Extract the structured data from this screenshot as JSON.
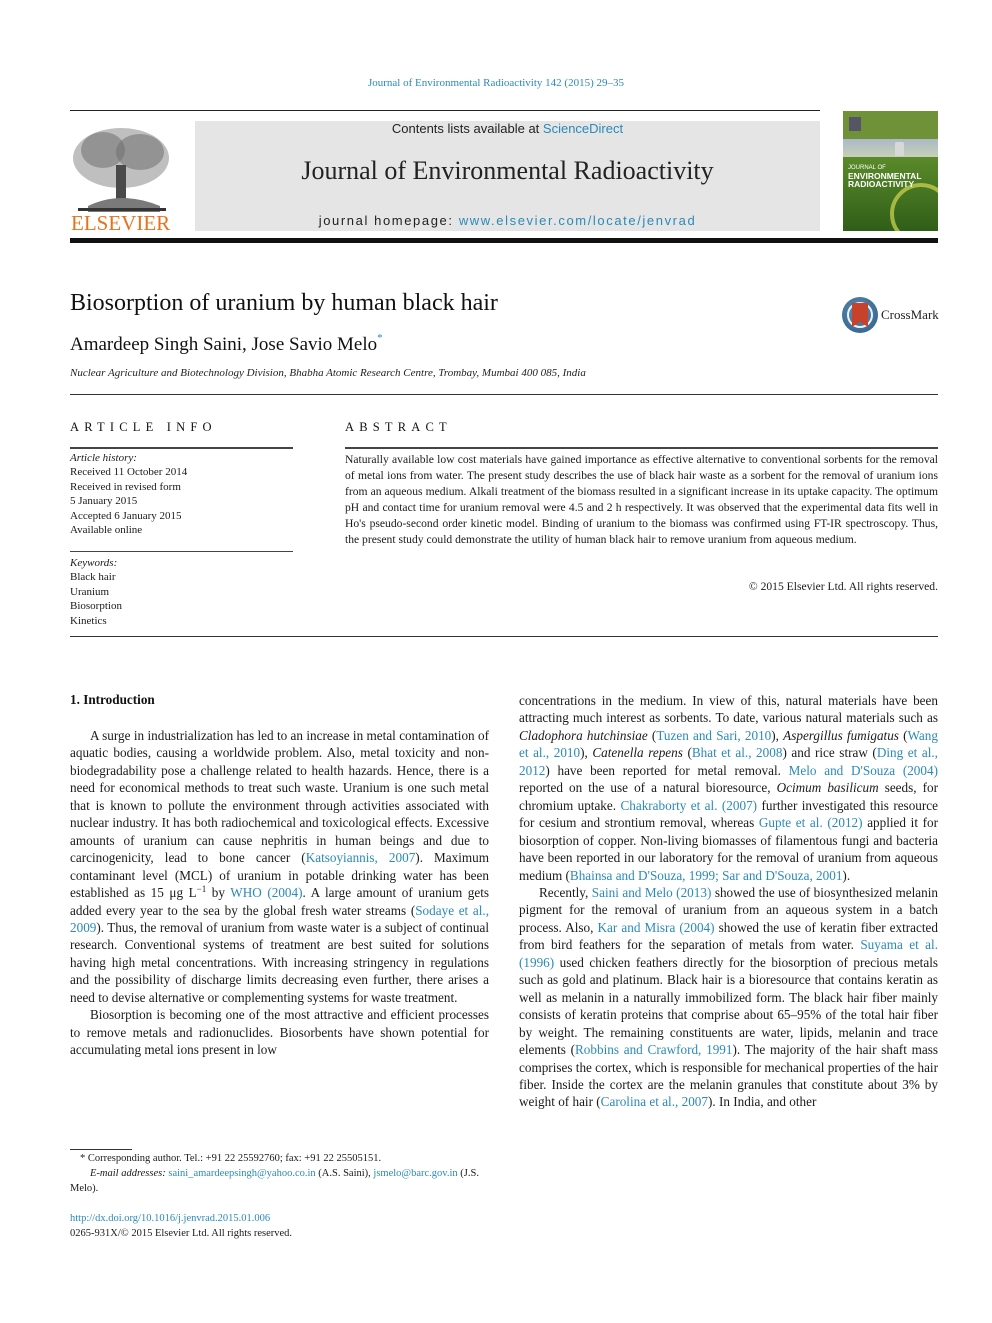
{
  "journal_ref": "Journal of Environmental Radioactivity 142 (2015) 29–35",
  "header": {
    "contents_prefix": "Contents lists available at ",
    "contents_link": "ScienceDirect",
    "journal_title": "Journal of Environmental Radioactivity",
    "homepage_prefix": "journal homepage: ",
    "homepage_link": "www.elsevier.com/locate/jenvrad",
    "publisher_logo": "ELSEVIER",
    "cover_title_lines": [
      "JOURNAL OF",
      "ENVIRONMENTAL",
      "RADIOACTIVITY"
    ],
    "brand_color": "#e9711c",
    "link_color": "#2a8ab8"
  },
  "article": {
    "title": "Biosorption of uranium by human black hair",
    "authors": "Amardeep Singh Saini, Jose Savio Melo",
    "corresponding_mark": "*",
    "affiliation": "Nuclear Agriculture and Biotechnology Division, Bhabha Atomic Research Centre, Trombay, Mumbai 400 085, India",
    "crossmark_label": "CrossMark"
  },
  "article_info": {
    "heading": "ARTICLE INFO",
    "history_label": "Article history:",
    "history": [
      "Received 11 October 2014",
      "Received in revised form",
      "5 January 2015",
      "Accepted 6 January 2015",
      "Available online"
    ],
    "keywords_label": "Keywords:",
    "keywords": [
      "Black hair",
      "Uranium",
      "Biosorption",
      "Kinetics"
    ]
  },
  "abstract": {
    "heading": "ABSTRACT",
    "text": "Naturally available low cost materials have gained importance as effective alternative to conventional sorbents for the removal of metal ions from water. The present study describes the use of black hair waste as a sorbent for the removal of uranium ions from an aqueous medium. Alkali treatment of the biomass resulted in a significant increase in its uptake capacity. The optimum pH and contact time for uranium removal were 4.5 and 2 h respectively. It was observed that the experimental data fits well in Ho's pseudo-second order kinetic model. Binding of uranium to the biomass was confirmed using FT-IR spectroscopy. Thus, the present study could demonstrate the utility of human black hair to remove uranium from aqueous medium.",
    "copyright": "© 2015 Elsevier Ltd. All rights reserved."
  },
  "body": {
    "section_heading": "1.  Introduction",
    "left_p1": [
      {
        "t": "A surge in industrialization has led to an increase in metal contamination of aquatic bodies, causing a worldwide problem. Also, metal toxicity and non-biodegradability pose a challenge related to health hazards. Hence, there is a need for economical methods to treat such waste. Uranium is one such metal that is known to pollute the environment through activities associated with nuclear industry. It has both radiochemical and toxicological effects. Excessive amounts of uranium can cause nephritis in human beings and due to carcinogenicity, lead to bone cancer ("
      },
      {
        "t": "Katsoyiannis, 2007",
        "link": true
      },
      {
        "t": "). Maximum contaminant level (MCL) of uranium in potable drinking water has been established as 15 μg L"
      },
      {
        "t": "−1",
        "sup": true
      },
      {
        "t": " by "
      },
      {
        "t": "WHO (2004)",
        "link": true
      },
      {
        "t": ". A large amount of uranium gets added every year to the sea by the global fresh water streams ("
      },
      {
        "t": "Sodaye et al., 2009",
        "link": true
      },
      {
        "t": "). Thus, the removal of uranium from waste water is a subject of continual research. Conventional systems of treatment are best suited for solutions having high metal concentrations. With increasing stringency in regulations and the possibility of discharge limits decreasing even further, there arises a need to devise alternative or complementing systems for waste treatment."
      }
    ],
    "left_p2": [
      {
        "t": "Biosorption is becoming one of the most attractive and efficient processes to remove metals and radionuclides. Biosorbents have shown potential for accumulating metal ions present in low"
      }
    ],
    "right_p1": [
      {
        "t": "concentrations in the medium. In view of this, natural materials have been attracting much interest as sorbents. To date, various natural materials such as "
      },
      {
        "t": "Cladophora hutchinsiae",
        "italic": true
      },
      {
        "t": " ("
      },
      {
        "t": "Tuzen and Sari, 2010",
        "link": true
      },
      {
        "t": "), "
      },
      {
        "t": "Aspergillus fumigatus",
        "italic": true
      },
      {
        "t": " ("
      },
      {
        "t": "Wang et al., 2010",
        "link": true
      },
      {
        "t": "), "
      },
      {
        "t": "Catenella repens",
        "italic": true
      },
      {
        "t": " ("
      },
      {
        "t": "Bhat et al., 2008",
        "link": true
      },
      {
        "t": ") and rice straw ("
      },
      {
        "t": "Ding et al., 2012",
        "link": true
      },
      {
        "t": ") have been reported for metal removal. "
      },
      {
        "t": "Melo and D'Souza (2004)",
        "link": true
      },
      {
        "t": " reported on the use of a natural bioresource, "
      },
      {
        "t": "Ocimum basilicum",
        "italic": true
      },
      {
        "t": " seeds, for chromium uptake. "
      },
      {
        "t": "Chakraborty et al. (2007)",
        "link": true
      },
      {
        "t": " further investigated this resource for cesium and strontium removal, whereas "
      },
      {
        "t": "Gupte et al. (2012)",
        "link": true
      },
      {
        "t": " applied it for biosorption of copper. Non-living biomasses of filamentous fungi and bacteria have been reported in our laboratory for the removal of uranium from aqueous medium ("
      },
      {
        "t": "Bhainsa and D'Souza, 1999; Sar and D'Souza, 2001",
        "link": true
      },
      {
        "t": ")."
      }
    ],
    "right_p2": [
      {
        "t": "Recently, "
      },
      {
        "t": "Saini and Melo (2013)",
        "link": true
      },
      {
        "t": " showed the use of biosynthesized melanin pigment for the removal of uranium from an aqueous system in a batch process. Also, "
      },
      {
        "t": "Kar and Misra (2004)",
        "link": true
      },
      {
        "t": " showed the use of keratin fiber extracted from bird feathers for the separation of metals from water. "
      },
      {
        "t": "Suyama et al. (1996)",
        "link": true
      },
      {
        "t": " used chicken feathers directly for the biosorption of precious metals such as gold and platinum. Black hair is a bioresource that contains keratin as well as melanin in a naturally immobilized form. The black hair fiber mainly consists of keratin proteins that comprise about 65–95% of the total hair fiber by weight. The remaining constituents are water, lipids, melanin and trace elements ("
      },
      {
        "t": "Robbins and Crawford, 1991",
        "link": true
      },
      {
        "t": "). The majority of the hair shaft mass comprises the cortex, which is responsible for mechanical properties of the hair fiber. Inside the cortex are the melanin granules that constitute about 3% by weight of hair ("
      },
      {
        "t": "Carolina et al., 2007",
        "link": true
      },
      {
        "t": "). In India, and other"
      }
    ]
  },
  "footnotes": {
    "corresponding": "* Corresponding author. Tel.: +91 22 25592760; fax: +91 22 25505151.",
    "email_label": "E-mail addresses:",
    "email1": "saini_amardeepsingh@yahoo.co.in",
    "email1_owner": " (A.S. Saini), ",
    "email2": "jsmelo@barc.gov.in",
    "email2_owner": " (J.S. Melo).",
    "doi": "http://dx.doi.org/10.1016/j.jenvrad.2015.01.006",
    "issn": "0265-931X/© 2015 Elsevier Ltd. All rights reserved."
  }
}
